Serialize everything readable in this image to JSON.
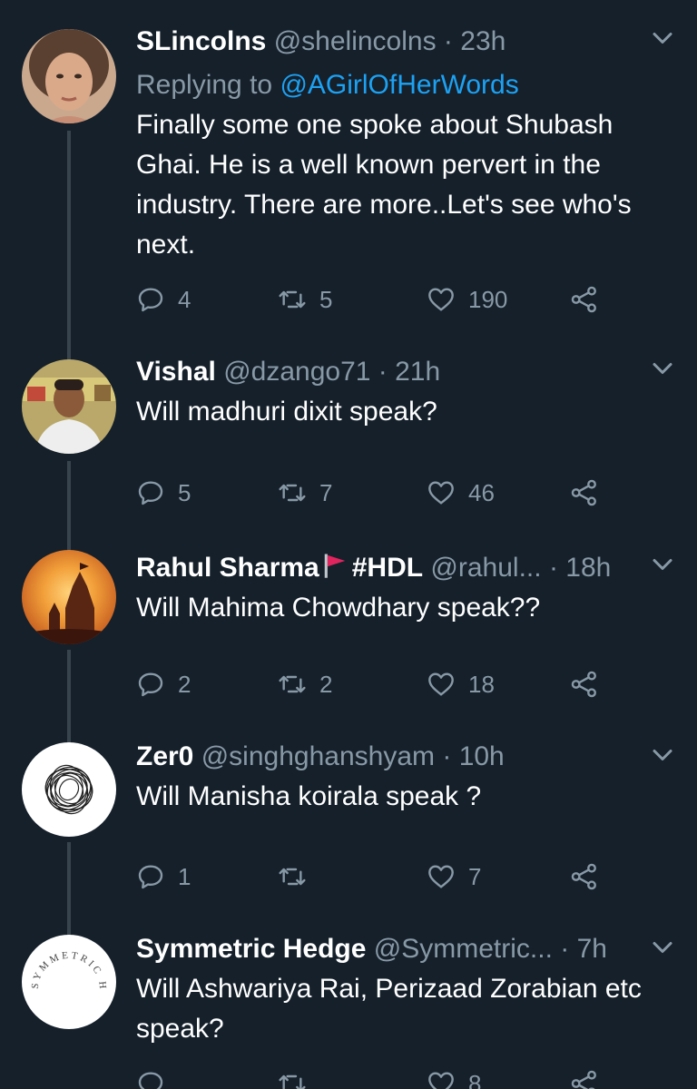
{
  "tweets": [
    {
      "name": "SLincolns",
      "handle": "@shelincolns",
      "time": "23h",
      "replying_label": "Replying to",
      "replying_to": "@AGirlOfHerWords",
      "text": "Finally some one spoke about Shubash Ghai. He is a well known pervert in the industry. There are more..Let's see who's next.",
      "replies": "4",
      "retweets": "5",
      "likes": "190"
    },
    {
      "name": "Vishal",
      "handle": "@dzango71",
      "time": "21h",
      "text": "Will madhuri dixit speak?",
      "replies": "5",
      "retweets": "7",
      "likes": "46"
    },
    {
      "name": "Rahul Sharma",
      "name_suffix": "#HDL",
      "handle": "@rahul...",
      "time": "18h",
      "text": "Will Mahima Chowdhary speak??",
      "replies": "2",
      "retweets": "2",
      "likes": "18"
    },
    {
      "name": "Zer0",
      "handle": "@singhghanshyam",
      "time": "10h",
      "text": "Will Manisha koirala speak ?",
      "replies": "1",
      "retweets": "",
      "likes": "7"
    },
    {
      "name": "Symmetric Hedge",
      "handle": "@Symmetric...",
      "time": "7h",
      "text": "Will Ashwariya Rai,  Perizaad Zorabian etc speak?",
      "avatar_text": "SYMMETRIC HEDGE",
      "replies": "",
      "retweets": "",
      "likes": "8"
    }
  ],
  "separator": "·",
  "colors": {
    "background": "#15202b",
    "secondary_text": "#8899a6",
    "link": "#1da1f2",
    "thread_line": "#38444d",
    "flag": "#e0245e"
  }
}
